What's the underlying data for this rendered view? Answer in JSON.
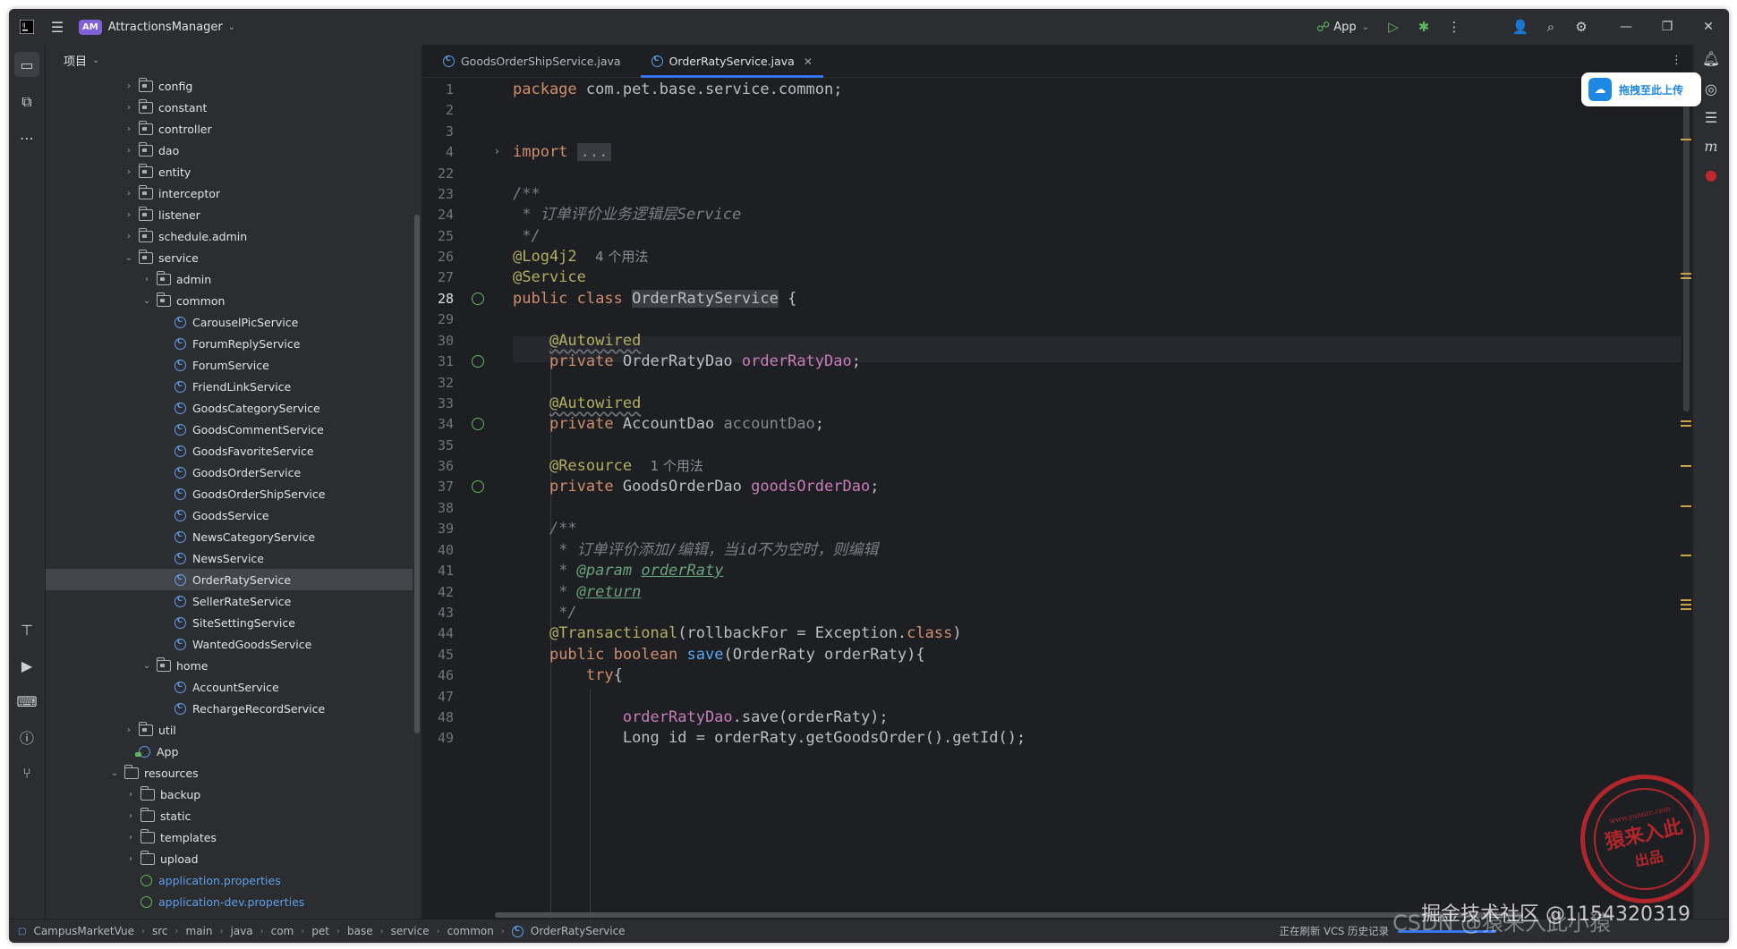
{
  "titlebar": {
    "project_badge": "AM",
    "project_name": "AttractionsManager",
    "run_config": "App"
  },
  "project_panel": {
    "header": "项目",
    "tree": [
      {
        "label": "config",
        "type": "folder",
        "depth": 1,
        "expanded": false
      },
      {
        "label": "constant",
        "type": "folder",
        "depth": 1,
        "expanded": false
      },
      {
        "label": "controller",
        "type": "folder",
        "depth": 1,
        "expanded": false
      },
      {
        "label": "dao",
        "type": "folder",
        "depth": 1,
        "expanded": false
      },
      {
        "label": "entity",
        "type": "folder",
        "depth": 1,
        "expanded": false
      },
      {
        "label": "interceptor",
        "type": "folder",
        "depth": 1,
        "expanded": false
      },
      {
        "label": "listener",
        "type": "folder",
        "depth": 1,
        "expanded": false
      },
      {
        "label": "schedule.admin",
        "type": "folder",
        "depth": 1,
        "expanded": false
      },
      {
        "label": "service",
        "type": "folder",
        "depth": 1,
        "expanded": true
      },
      {
        "label": "admin",
        "type": "folder",
        "depth": 2,
        "expanded": false
      },
      {
        "label": "common",
        "type": "folder",
        "depth": 2,
        "expanded": true
      },
      {
        "label": "CarouselPicService",
        "type": "class",
        "depth": 3
      },
      {
        "label": "ForumReplyService",
        "type": "class",
        "depth": 3
      },
      {
        "label": "ForumService",
        "type": "class",
        "depth": 3
      },
      {
        "label": "FriendLinkService",
        "type": "class",
        "depth": 3
      },
      {
        "label": "GoodsCategoryService",
        "type": "class",
        "depth": 3
      },
      {
        "label": "GoodsCommentService",
        "type": "class",
        "depth": 3
      },
      {
        "label": "GoodsFavoriteService",
        "type": "class",
        "depth": 3
      },
      {
        "label": "GoodsOrderService",
        "type": "class",
        "depth": 3
      },
      {
        "label": "GoodsOrderShipService",
        "type": "class",
        "depth": 3
      },
      {
        "label": "GoodsService",
        "type": "class",
        "depth": 3
      },
      {
        "label": "NewsCategoryService",
        "type": "class",
        "depth": 3
      },
      {
        "label": "NewsService",
        "type": "class",
        "depth": 3
      },
      {
        "label": "OrderRatyService",
        "type": "class",
        "depth": 3,
        "selected": true
      },
      {
        "label": "SellerRateService",
        "type": "class",
        "depth": 3
      },
      {
        "label": "SiteSettingService",
        "type": "class",
        "depth": 3
      },
      {
        "label": "WantedGoodsService",
        "type": "class",
        "depth": 3
      },
      {
        "label": "home",
        "type": "folder",
        "depth": 2,
        "expanded": true
      },
      {
        "label": "AccountService",
        "type": "class",
        "depth": 3
      },
      {
        "label": "RechargeRecordService",
        "type": "class",
        "depth": 3
      },
      {
        "label": "util",
        "type": "folder",
        "depth": 1,
        "expanded": false
      },
      {
        "label": "App",
        "type": "app",
        "depth": 1
      },
      {
        "label": "resources",
        "type": "folder",
        "depth": 0,
        "expanded": true
      },
      {
        "label": "backup",
        "type": "folder",
        "depth": 0.5,
        "expanded": false
      },
      {
        "label": "static",
        "type": "folder",
        "depth": 0.5,
        "expanded": false
      },
      {
        "label": "templates",
        "type": "folder",
        "depth": 0.5,
        "expanded": false
      },
      {
        "label": "upload",
        "type": "folder",
        "depth": 0.5,
        "expanded": false
      },
      {
        "label": "application.properties",
        "type": "props",
        "depth": 0.5
      },
      {
        "label": "application-dev.properties",
        "type": "props",
        "depth": 0.5
      }
    ]
  },
  "editor": {
    "tabs": [
      {
        "label": "GoodsOrderShipService.java",
        "active": false
      },
      {
        "label": "OrderRatyService.java",
        "active": true
      }
    ],
    "line_numbers": [
      "1",
      "2",
      "3",
      "4",
      "22",
      "23",
      "24",
      "25",
      "26",
      "27",
      "28",
      "29",
      "30",
      "31",
      "32",
      "33",
      "34",
      "35",
      "36",
      "37",
      "38",
      "39",
      "40",
      "41",
      "42",
      "43",
      "44",
      "45",
      "46",
      "47",
      "48",
      "49"
    ],
    "current_line": "28",
    "code": {
      "l1_kw": "package",
      "l1_rest": " com.pet.base.service.common;",
      "l4_kw": "import",
      "l4_fold": "...",
      "l23": "/**",
      "l24": " * 订单评价业务逻辑层Service",
      "l25": " */",
      "l26_ann": "@Log4j2",
      "l26_hint": "4 个用法",
      "l27_ann": "@Service",
      "l28_kw": "public class",
      "l28_cls": "OrderRatyService",
      "l28_rest": " {",
      "l30_ann": "@Autowired",
      "l31_kw": "private",
      "l31_type": " OrderRatyDao ",
      "l31_fld": "orderRatyDao",
      "l31_end": ";",
      "l33_ann": "@Autowired",
      "l34_kw": "private",
      "l34_type": " AccountDao ",
      "l34_fld": "accountDao",
      "l34_end": ";",
      "l36_ann": "@Resource",
      "l36_hint": "1 个用法",
      "l37_kw": "private",
      "l37_type": " GoodsOrderDao ",
      "l37_fld": "goodsOrderDao",
      "l37_end": ";",
      "l39": "/**",
      "l40": " * 订单评价添加/编辑，当id不为空时，则编辑",
      "l41_pre": " * ",
      "l41_tag": "@param",
      "l41_arg": "orderRaty",
      "l42_pre": " * ",
      "l42_tag": "@return",
      "l43": " */",
      "l44_ann": "@Transactional",
      "l44_a": "(rollbackFor = Exception.",
      "l44_kw": "class",
      "l44_b": ")",
      "l45_kw": "public boolean",
      "l45_fn": "save",
      "l45_rest": "(OrderRaty orderRaty){",
      "l46_kw": "try",
      "l46_rest": "{",
      "l48_fld": "orderRatyDao",
      "l48_rest": ".save(orderRaty);",
      "l49_a": "Long id = orderRaty.getGoodsOrder().getId();"
    }
  },
  "upload_button": {
    "label": "拖拽至此上传"
  },
  "statusbar": {
    "breadcrumbs": [
      "CampusMarketVue",
      "src",
      "main",
      "java",
      "com",
      "pet",
      "base",
      "service",
      "common",
      "OrderRatyService"
    ],
    "status_text": "正在刷新 VCS 历史记录"
  },
  "watermarks": {
    "stamp_url": "www.yuanrc.com",
    "stamp_main": "猿来入此",
    "stamp_sub": "出品",
    "csdn": "CSDN @猿来入此小猿",
    "juejin": "掘金技术社区 @1154320319"
  },
  "colors": {
    "accent": "#3574f0",
    "keyword": "#cf8e6d",
    "annotation": "#b3ae60",
    "field": "#c77dbb",
    "function": "#56a8f5",
    "stamp": "#c0272d"
  }
}
